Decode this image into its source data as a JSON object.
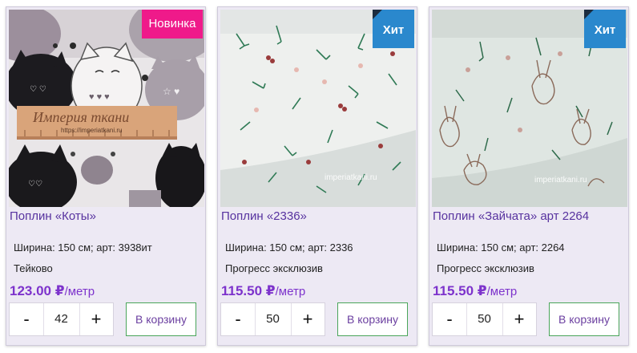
{
  "products": [
    {
      "badge": "Новинка",
      "title": "Поплин «Коты»",
      "spec": "Ширина: 150 см; арт: 3938ит",
      "maker": "Тейково",
      "price": "123.00 ₽",
      "unit": "/метр",
      "qty": "42",
      "minus": "-",
      "plus": "+",
      "cart": "В корзину",
      "ruler_text": "Империя ткани",
      "ruler_url": "https://imperiatkani.ru"
    },
    {
      "badge": "Хит",
      "title": "Поплин «2336»",
      "spec": "Ширина: 150 см; арт: 2336",
      "maker": "Прогресс эксклюзив",
      "price": "115.50 ₽",
      "unit": "/метр",
      "qty": "50",
      "minus": "-",
      "plus": "+",
      "cart": "В корзину",
      "watermark": "imperiatkani.ru"
    },
    {
      "badge": "Хит",
      "title": "Поплин «Зайчата» арт 2264",
      "spec": "Ширина: 150 см; арт: 2264",
      "maker": "Прогресс эксклюзив",
      "price": "115.50 ₽",
      "unit": "/метр",
      "qty": "50",
      "minus": "-",
      "plus": "+",
      "cart": "В корзину",
      "watermark": "imperiatkani.ru"
    }
  ],
  "colors": {
    "card_bg": "#ede9f4",
    "title": "#57329f",
    "price": "#7d33cc",
    "badge_new": "#ef1a8a",
    "badge_hit": "#2a88cd",
    "cart_border": "#4aa55a"
  }
}
